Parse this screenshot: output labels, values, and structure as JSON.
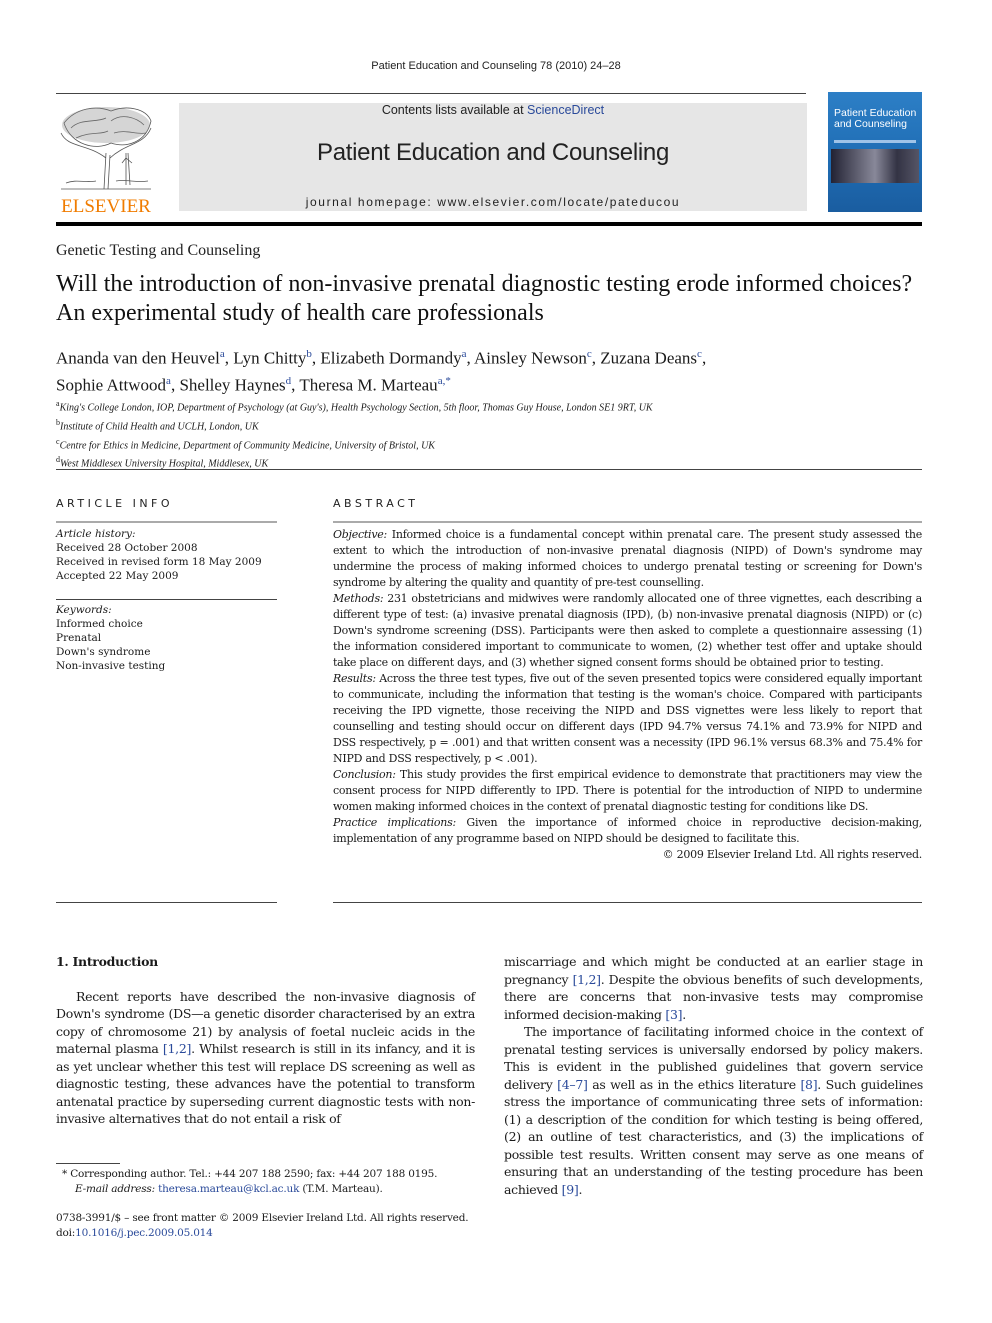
{
  "running_head": "Patient Education and Counseling 78 (2010) 24–28",
  "banner": {
    "contents_prefix": "Contents lists available at ",
    "contents_link": "ScienceDirect",
    "journal_title": "Patient Education and Counseling",
    "homepage": "journal homepage: www.elsevier.com/locate/pateducou"
  },
  "publisher_logo": "ELSEVIER",
  "cover": {
    "title_line1": "Patient Education",
    "title_line2": "and Counseling"
  },
  "section_label": "Genetic Testing and Counseling",
  "article_title": "Will the introduction of non-invasive prenatal diagnostic testing erode informed choices? An experimental study of health care professionals",
  "authors": [
    {
      "name": "Ananda van den Heuvel",
      "aff": "a"
    },
    {
      "name": "Lyn Chitty",
      "aff": "b"
    },
    {
      "name": "Elizabeth Dormandy",
      "aff": "a"
    },
    {
      "name": "Ainsley Newson",
      "aff": "c"
    },
    {
      "name": "Zuzana Deans",
      "aff": "c"
    },
    {
      "name": "Sophie Attwood",
      "aff": "a"
    },
    {
      "name": "Shelley Haynes",
      "aff": "d"
    },
    {
      "name": "Theresa M. Marteau",
      "aff": "a,*"
    }
  ],
  "affiliations": [
    {
      "key": "a",
      "text": "King's College London, IOP, Department of Psychology (at Guy's), Health Psychology Section, 5th floor, Thomas Guy House, London SE1 9RT, UK"
    },
    {
      "key": "b",
      "text": "Institute of Child Health and UCLH, London, UK"
    },
    {
      "key": "c",
      "text": "Centre for Ethics in Medicine, Department of Community Medicine, University of Bristol, UK"
    },
    {
      "key": "d",
      "text": "West Middlesex University Hospital, Middlesex, UK"
    }
  ],
  "article_info": {
    "heading": "ARTICLE INFO",
    "history_label": "Article history:",
    "history": [
      "Received 28 October 2008",
      "Received in revised form 18 May 2009",
      "Accepted 22 May 2009"
    ],
    "keywords_label": "Keywords:",
    "keywords": [
      "Informed choice",
      "Prenatal",
      "Down's syndrome",
      "Non-invasive testing"
    ]
  },
  "abstract": {
    "heading": "ABSTRACT",
    "sections": [
      {
        "label": "Objective:",
        "text": " Informed choice is a fundamental concept within prenatal care. The present study assessed the extent to which the introduction of non-invasive prenatal diagnosis (NIPD) of Down's syndrome may undermine the process of making informed choices to undergo prenatal testing or screening for Down's syndrome by altering the quality and quantity of pre-test counselling."
      },
      {
        "label": "Methods:",
        "text": " 231 obstetricians and midwives were randomly allocated one of three vignettes, each describing a different type of test: (a) invasive prenatal diagnosis (IPD), (b) non-invasive prenatal diagnosis (NIPD) or (c) Down's syndrome screening (DSS). Participants were then asked to complete a questionnaire assessing (1) the information considered important to communicate to women, (2) whether test offer and uptake should take place on different days, and (3) whether signed consent forms should be obtained prior to testing."
      },
      {
        "label": "Results:",
        "text": " Across the three test types, five out of the seven presented topics were considered equally important to communicate, including the information that testing is the woman's choice. Compared with participants receiving the IPD vignette, those receiving the NIPD and DSS vignettes were less likely to report that counselling and testing should occur on different days (IPD 94.7% versus 74.1% and 73.9% for NIPD and DSS respectively, p = .001) and that written consent was a necessity (IPD 96.1% versus 68.3% and 75.4% for NIPD and DSS respectively, p < .001)."
      },
      {
        "label": "Conclusion:",
        "text": " This study provides the first empirical evidence to demonstrate that practitioners may view the consent process for NIPD differently to IPD. There is potential for the introduction of NIPD to undermine women making informed choices in the context of prenatal diagnostic testing for conditions like DS."
      },
      {
        "label": "Practice implications:",
        "text": " Given the importance of informed choice in reproductive decision-making, implementation of any programme based on NIPD should be designed to facilitate this."
      }
    ],
    "copyright": "© 2009 Elsevier Ireland Ltd. All rights reserved."
  },
  "body": {
    "section_heading": "1.  Introduction",
    "left_p1_a": "Recent reports have described the non-invasive diagnosis of Down's syndrome (DS—a genetic disorder characterised by an extra copy of chromosome 21) by analysis of foetal nucleic acids in the maternal plasma ",
    "left_p1_ref": "[1,2]",
    "left_p1_b": ". Whilst research is still in its infancy, and it is as yet unclear whether this test will replace DS screening as well as diagnostic testing, these advances have the potential to transform antenatal practice by superseding current diagnostic tests with non-invasive alternatives that do not entail a risk of",
    "right_p1_a": "miscarriage and which might be conducted at an earlier stage in pregnancy ",
    "right_p1_ref1": "[1,2]",
    "right_p1_b": ". Despite the obvious benefits of such developments, there are concerns that non-invasive tests may compromise informed decision-making ",
    "right_p1_ref2": "[3]",
    "right_p1_c": ".",
    "right_p2_a": "The importance of facilitating informed choice in the context of prenatal testing services is universally endorsed by policy makers. This is evident in the published guidelines that govern service delivery ",
    "right_p2_ref1": "[4–7]",
    "right_p2_b": " as well as in the ethics literature ",
    "right_p2_ref2": "[8]",
    "right_p2_c": ". Such guidelines stress the importance of communicating three sets of information: (1) a description of the condition for which testing is being offered, (2) an outline of test characteristics, and (3) the implications of possible test results. Written consent may serve as one means of ensuring that an understanding of the testing procedure has been achieved ",
    "right_p2_ref3": "[9]",
    "right_p2_d": "."
  },
  "footnote": {
    "marker": "*",
    "corresponding": " Corresponding author. Tel.: +44 207 188 2590; fax: +44 207 188 0195.",
    "email_label": "E-mail address:",
    "email": "theresa.marteau@kcl.ac.uk",
    "email_suffix": " (T.M. Marteau)."
  },
  "front_matter": {
    "issn_line": "0738-3991/$ – see front matter © 2009 Elsevier Ireland Ltd. All rights reserved.",
    "doi_prefix": "doi:",
    "doi": "10.1016/j.pec.2009.05.014"
  },
  "colors": {
    "link": "#2a4a9a",
    "elsevier_orange": "#f07c00",
    "banner_bg": "#e6e6e6",
    "cover_blue": "#1f6db4"
  }
}
